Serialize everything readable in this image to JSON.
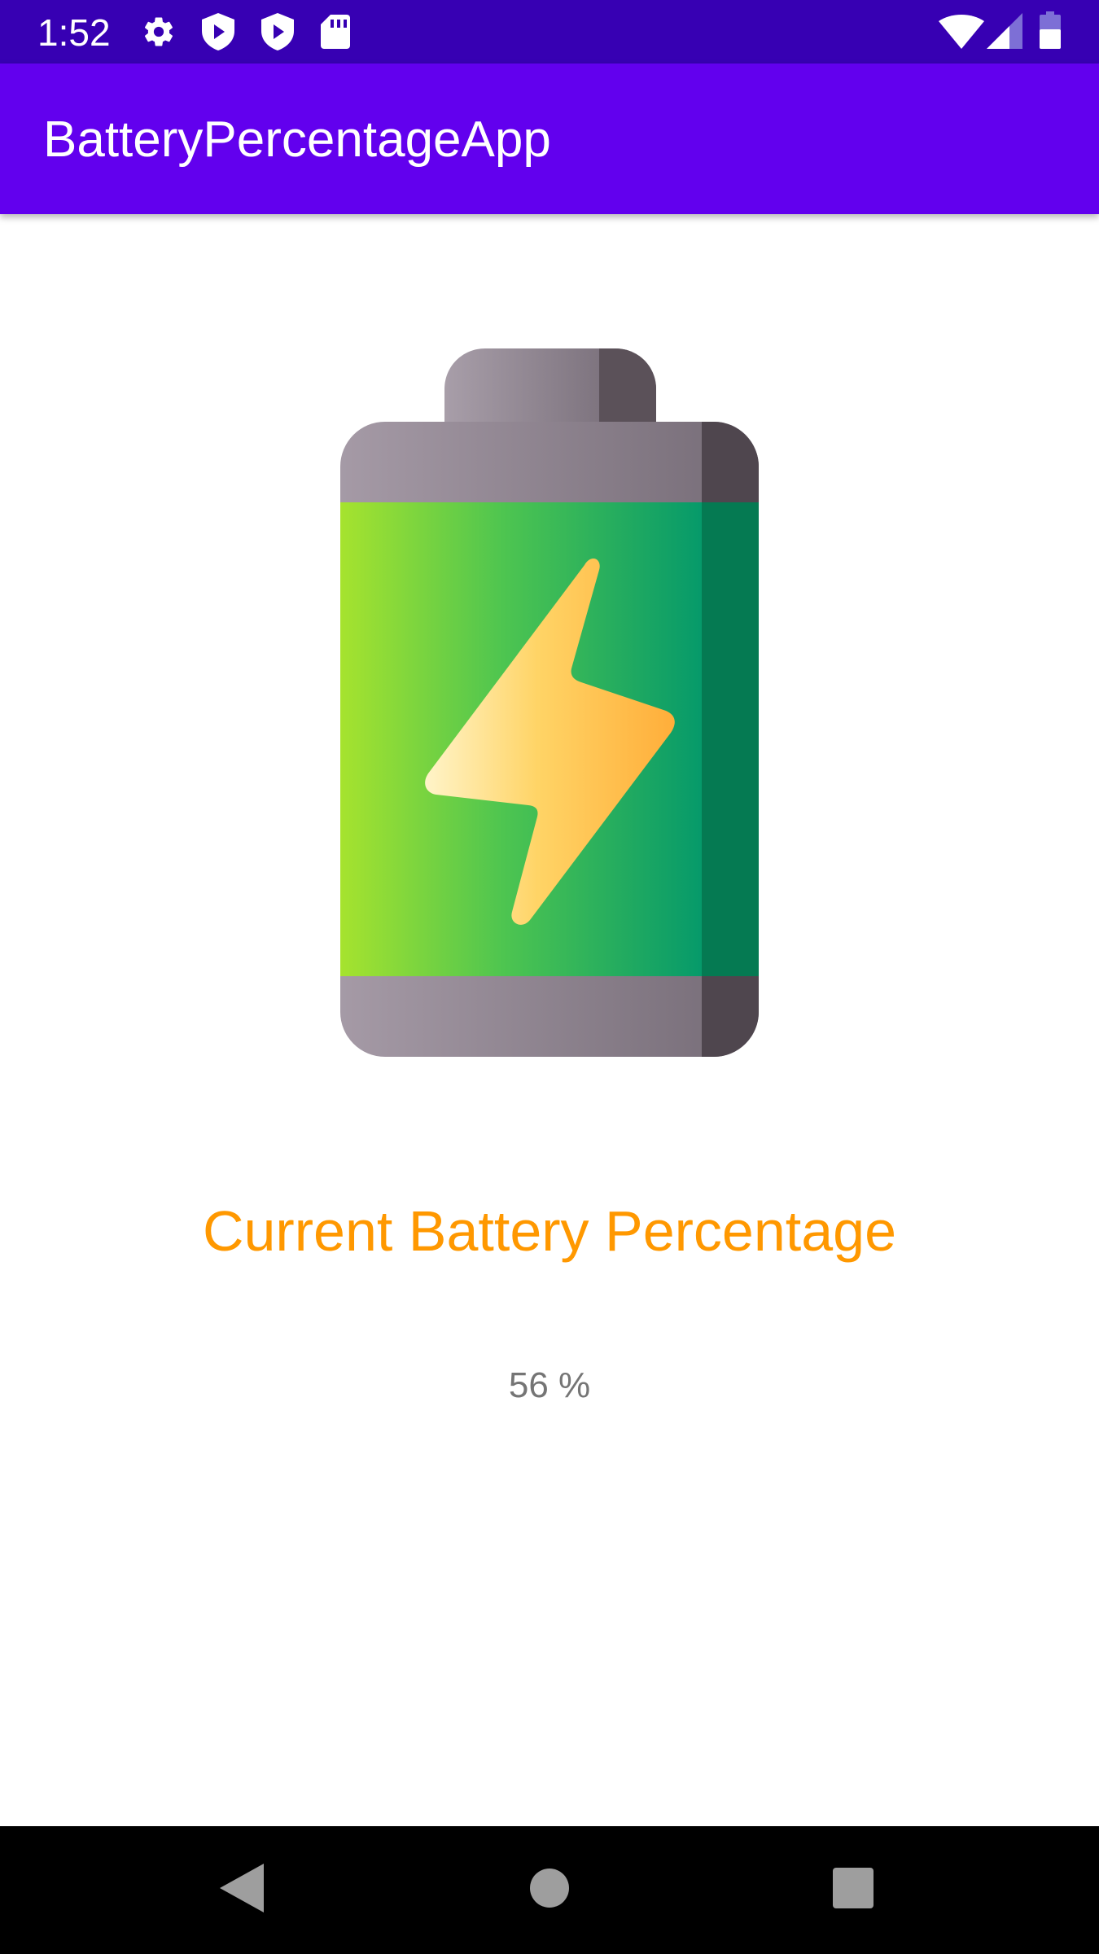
{
  "status_bar": {
    "time": "1:52",
    "left_icons": [
      "settings-icon",
      "shield-icon",
      "shield-icon",
      "sd-card-icon"
    ],
    "right_icons": [
      "wifi-icon",
      "cellular-signal-icon",
      "battery-icon"
    ],
    "background_color": "#3700b3"
  },
  "app_bar": {
    "title": "BatteryPercentageApp",
    "background_color": "#6200ee"
  },
  "main": {
    "illustration_icon": "battery-charging-icon",
    "heading": "Current Battery Percentage",
    "heading_color": "#ff9800",
    "percentage": "56 %"
  },
  "nav_bar": {
    "buttons": [
      "back-icon",
      "home-icon",
      "recents-icon"
    ]
  }
}
